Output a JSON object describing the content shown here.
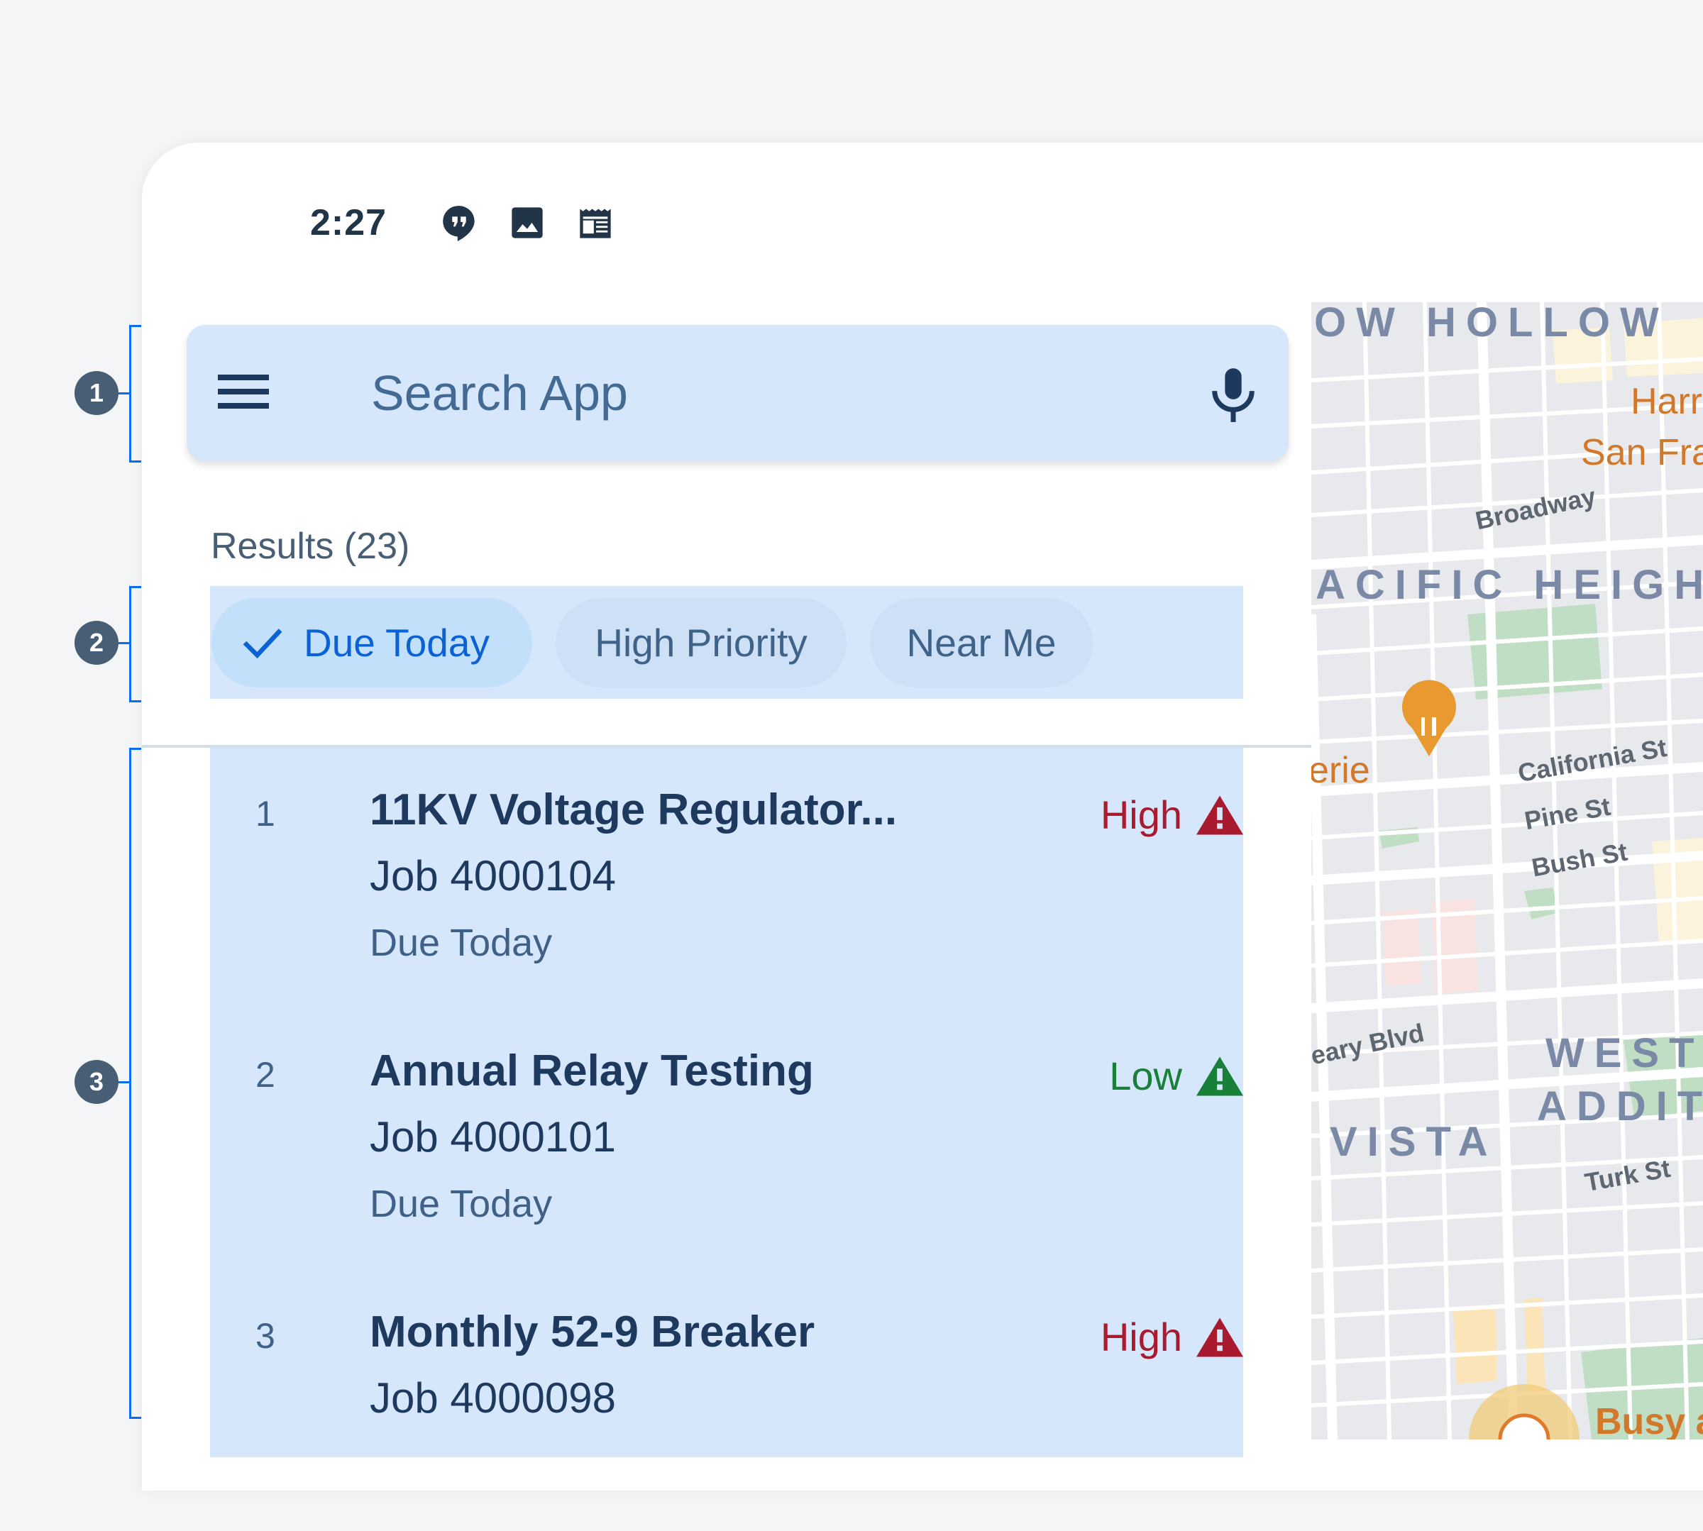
{
  "status_bar": {
    "time": "2:27",
    "icons": [
      "hangouts-icon",
      "image-icon",
      "newspaper-icon"
    ]
  },
  "search": {
    "placeholder": "Search App",
    "value": "",
    "menu_icon": "hamburger-menu-icon",
    "mic_icon": "microphone-icon"
  },
  "results": {
    "label": "Results (23)"
  },
  "filters": [
    {
      "label": "Due Today",
      "selected": true,
      "icon": "check-icon"
    },
    {
      "label": "High Priority",
      "selected": false
    },
    {
      "label": "Near Me",
      "selected": false
    }
  ],
  "list": [
    {
      "index": "1",
      "title": "11KV Voltage Regulator...",
      "job": "Job 4000104",
      "due": "Due Today",
      "priority": "High",
      "priority_color": "#aa1a2f"
    },
    {
      "index": "2",
      "title": "Annual Relay Testing",
      "job": "Job 4000101",
      "due": "Due Today",
      "priority": "Low",
      "priority_color": "#188038"
    },
    {
      "index": "3",
      "title": "Monthly 52-9 Breaker",
      "job": "Job 4000098",
      "due": "",
      "priority": "High",
      "priority_color": "#aa1a2f"
    }
  ],
  "map": {
    "areas": [
      "OW HOLLOW",
      "ACIFIC HEIGHT",
      "WESTE",
      "ADDIT",
      "VISTA"
    ],
    "streets": [
      "Broadway",
      "California St",
      "Pine St",
      "Bush St",
      "eary Blvd",
      "Turk St"
    ],
    "pois": [
      "Harr",
      "San Fra",
      "erie",
      "Busy a"
    ],
    "poi_icons": [
      "restaurant-pin-icon",
      "busy-area-icon"
    ]
  },
  "annotations": [
    "1",
    "2",
    "3"
  ],
  "colors": {
    "accent": "#0a62d5",
    "panel_bg": "#d6e7fb",
    "text_primary": "#1d3a5e",
    "high": "#aa1a2f",
    "low": "#188038"
  }
}
